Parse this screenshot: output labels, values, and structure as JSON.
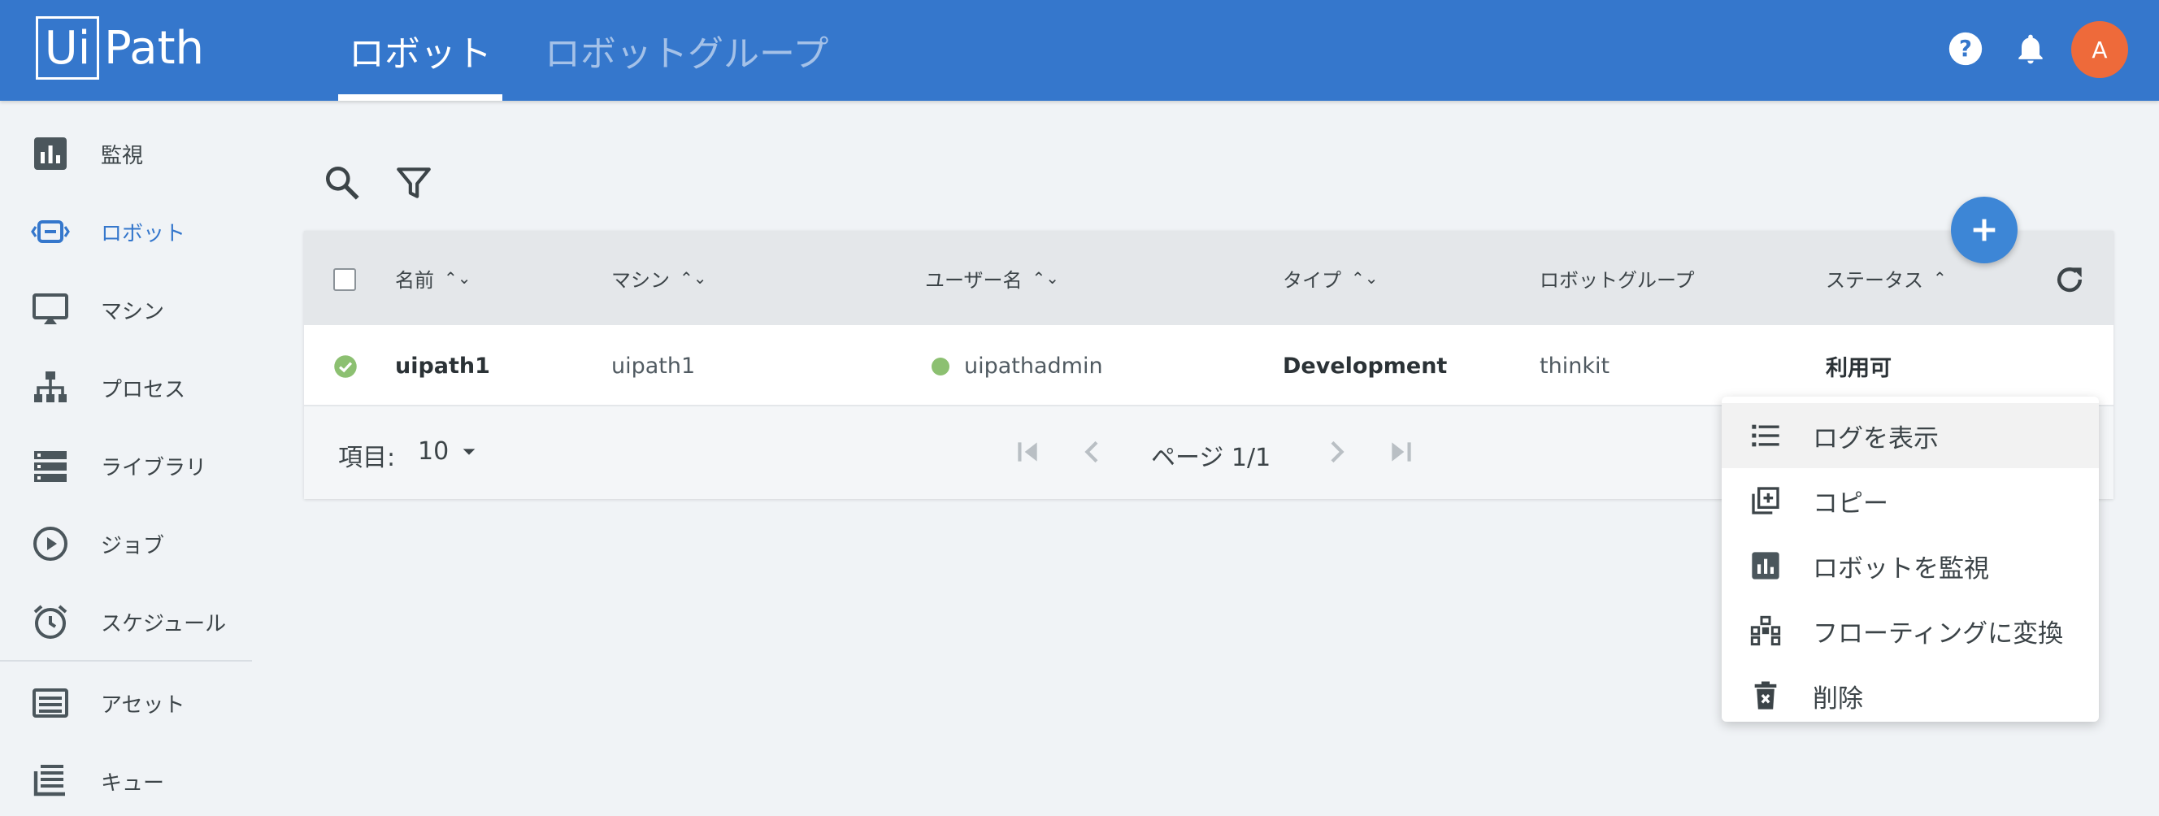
{
  "header": {
    "logo_left": "Ui",
    "logo_right": "Path",
    "tabs": [
      {
        "label": "ロボット",
        "active": true
      },
      {
        "label": "ロボットグループ",
        "active": false
      }
    ],
    "avatar_initial": "A"
  },
  "sidebar": {
    "items": [
      {
        "label": "監視",
        "icon": "chart-icon"
      },
      {
        "label": "ロボット",
        "icon": "robot-icon",
        "active": true
      },
      {
        "label": "マシン",
        "icon": "monitor-icon"
      },
      {
        "label": "プロセス",
        "icon": "sitemap-icon"
      },
      {
        "label": "ライブラリ",
        "icon": "library-icon"
      },
      {
        "label": "ジョブ",
        "icon": "play-icon"
      },
      {
        "label": "スケジュール",
        "icon": "alarm-icon"
      },
      {
        "label": "アセット",
        "icon": "asset-icon"
      },
      {
        "label": "キュー",
        "icon": "queue-icon"
      }
    ]
  },
  "table": {
    "columns": [
      "名前",
      "マシン",
      "ユーザー名",
      "タイプ",
      "ロボットグループ",
      "ステータス"
    ],
    "rows": [
      {
        "name": "uipath1",
        "machine": "uipath1",
        "username": "uipathadmin",
        "type": "Development",
        "group": "thinkit",
        "status": "利用可"
      }
    ],
    "footer": {
      "items_label": "項目:",
      "items_value": "10",
      "page_label": "ページ 1/1"
    }
  },
  "context_menu": {
    "items": [
      {
        "label": "ログを表示",
        "icon": "list-icon"
      },
      {
        "label": "コピー",
        "icon": "copy-icon"
      },
      {
        "label": "ロボットを監視",
        "icon": "chart-icon"
      },
      {
        "label": "フローティングに変換",
        "icon": "floating-icon"
      },
      {
        "label": "削除",
        "icon": "trash-icon"
      }
    ]
  },
  "colors": {
    "header": "#3577cc",
    "accent": "#3577cc",
    "avatar": "#ee6a3a",
    "status_ok": "#8cc071"
  }
}
